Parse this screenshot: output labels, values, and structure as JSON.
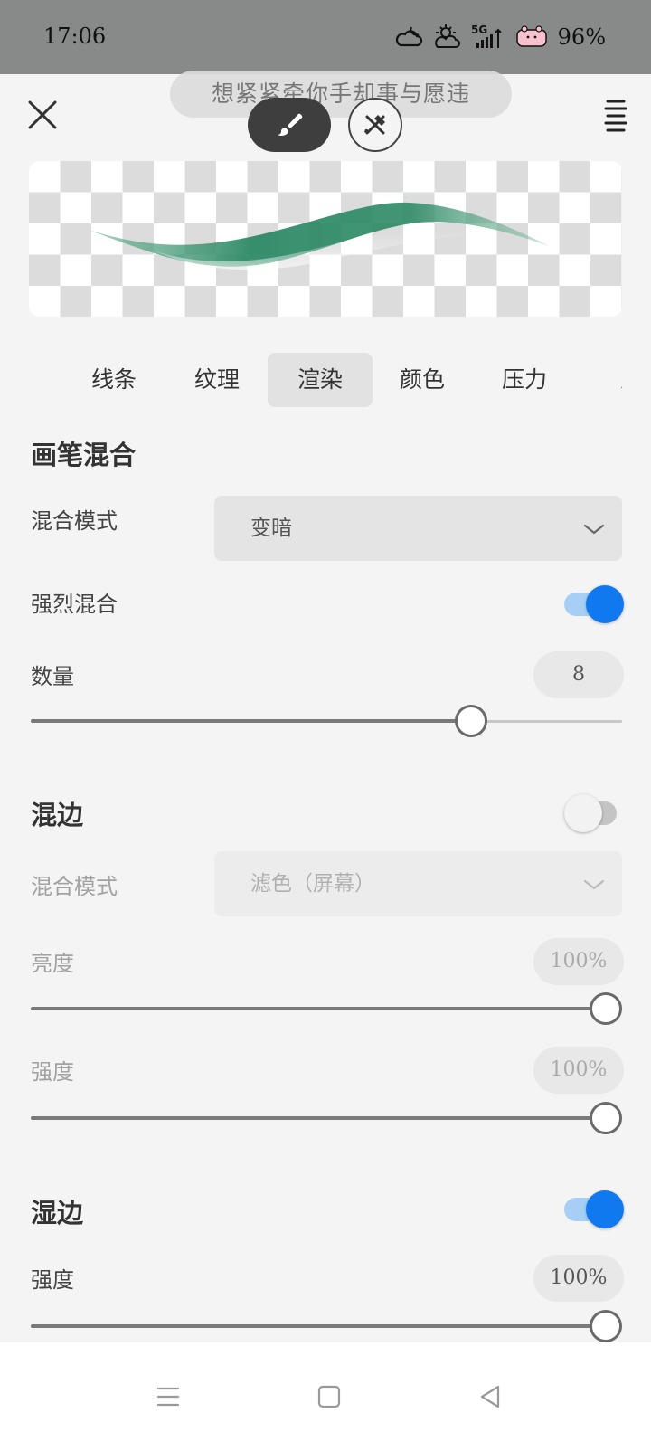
{
  "status_bar": {
    "time": "17:06",
    "network": "5G",
    "battery": "96%",
    "icons": [
      "weather-cloudy-night-icon",
      "weather-cloudy-sun-icon",
      "signal-5g-icon",
      "battery-icon"
    ]
  },
  "header": {
    "lyric": "想紧紧牵你手却事与愿违",
    "close_icon": "close-icon",
    "menu_icon": "menu-icon",
    "brush_icon": "brush-icon",
    "eraser_icon": "eraser-icon"
  },
  "preview": {
    "stroke_color": "#2e8a66"
  },
  "tabs": [
    {
      "label": "线条"
    },
    {
      "label": "纹理"
    },
    {
      "label": "渲染"
    },
    {
      "label": "颜色"
    },
    {
      "label": "压力"
    }
  ],
  "active_tab": "渲染",
  "brush_blend": {
    "title": "画笔混合",
    "mode_label": "混合模式",
    "mode_value": "变暗",
    "intense_label": "强烈混合",
    "intense_on": true,
    "amount_label": "数量",
    "amount_value": "8",
    "amount_fraction": 0.745
  },
  "blend_edge": {
    "title": "混边",
    "enabled": false,
    "mode_label": "混合模式",
    "mode_value": "滤色（屏幕）",
    "brightness_label": "亮度",
    "brightness_value": "100%",
    "brightness_fraction": 1.0,
    "strength_label": "强度",
    "strength_value": "100%",
    "strength_fraction": 1.0
  },
  "wet_edge": {
    "title": "湿边",
    "enabled": true,
    "strength_label": "强度",
    "strength_value": "100%",
    "strength_fraction": 1.0
  },
  "accent_color": "#1179ef",
  "navbar": {
    "icons": [
      "recent-apps-icon",
      "home-icon",
      "back-icon"
    ]
  }
}
